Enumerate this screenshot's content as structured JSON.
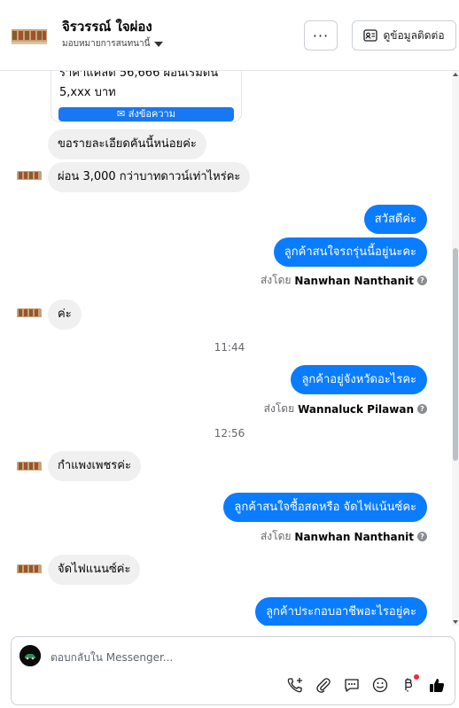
{
  "header": {
    "contact_name": "จิรวรรณ์ ใจผ่อง",
    "assignment": "มอบหมายการสนทนานี้",
    "more_label": "···",
    "contact_button": "ดูข้อมูลติดต่อ"
  },
  "card": {
    "line1": "ราคาแคสด 56,666 ผ่อนเริ่มต้น",
    "line2": "5,xxx บาท",
    "button": "ส่งข้อความ"
  },
  "messages": [
    {
      "side": "in",
      "text": "ขอรายละเอียดคันนี้หน่อยค่ะ"
    },
    {
      "side": "in",
      "text": "ผ่อน 3,000 กว่าบาทดาวน์เท่าไหร่คะ"
    },
    {
      "side": "out",
      "text": "สวัสดีค่ะ"
    },
    {
      "side": "out",
      "text": "ลูกค้าสนใจรถรุ่นนี้อยู่นะคะ"
    },
    {
      "side": "in",
      "text": "ค่ะ"
    },
    {
      "side": "out",
      "text": "ลูกค้าอยู่จังหวัดอะไรคะ"
    },
    {
      "side": "in",
      "text": "กำแพงเพชรค่ะ"
    },
    {
      "side": "out",
      "text": "ลูกค้าสนใจซื้อสดหรือ จัดไฟแน้นซ์คะ"
    },
    {
      "side": "in",
      "text": "จัดไฟแนนซ์ค่ะ"
    },
    {
      "side": "out",
      "text": "ลูกค้าประกอบอาชีพอะไรอยู่คะ"
    }
  ],
  "sent_by": [
    {
      "prefix": "ส่งโดย",
      "name": "Nanwhan Nanthanit"
    },
    {
      "prefix": "ส่งโดย",
      "name": "Wannaluck Pilawan"
    },
    {
      "prefix": "ส่งโดย",
      "name": "Nanwhan Nanthanit"
    }
  ],
  "times": [
    "11:44",
    "12:56"
  ],
  "composer": {
    "placeholder": "ตอบกลับใน Messenger..."
  },
  "colors": {
    "outgoing_bubble": "#0a7cff",
    "incoming_bubble": "#f0f0f0",
    "like_icon": "#050505"
  },
  "icons": [
    "more-icon",
    "contact-card-icon",
    "messenger-icon",
    "help-icon",
    "call-add-icon",
    "attach-icon",
    "saved-reply-icon",
    "emoji-icon",
    "payment-icon",
    "like-icon"
  ]
}
